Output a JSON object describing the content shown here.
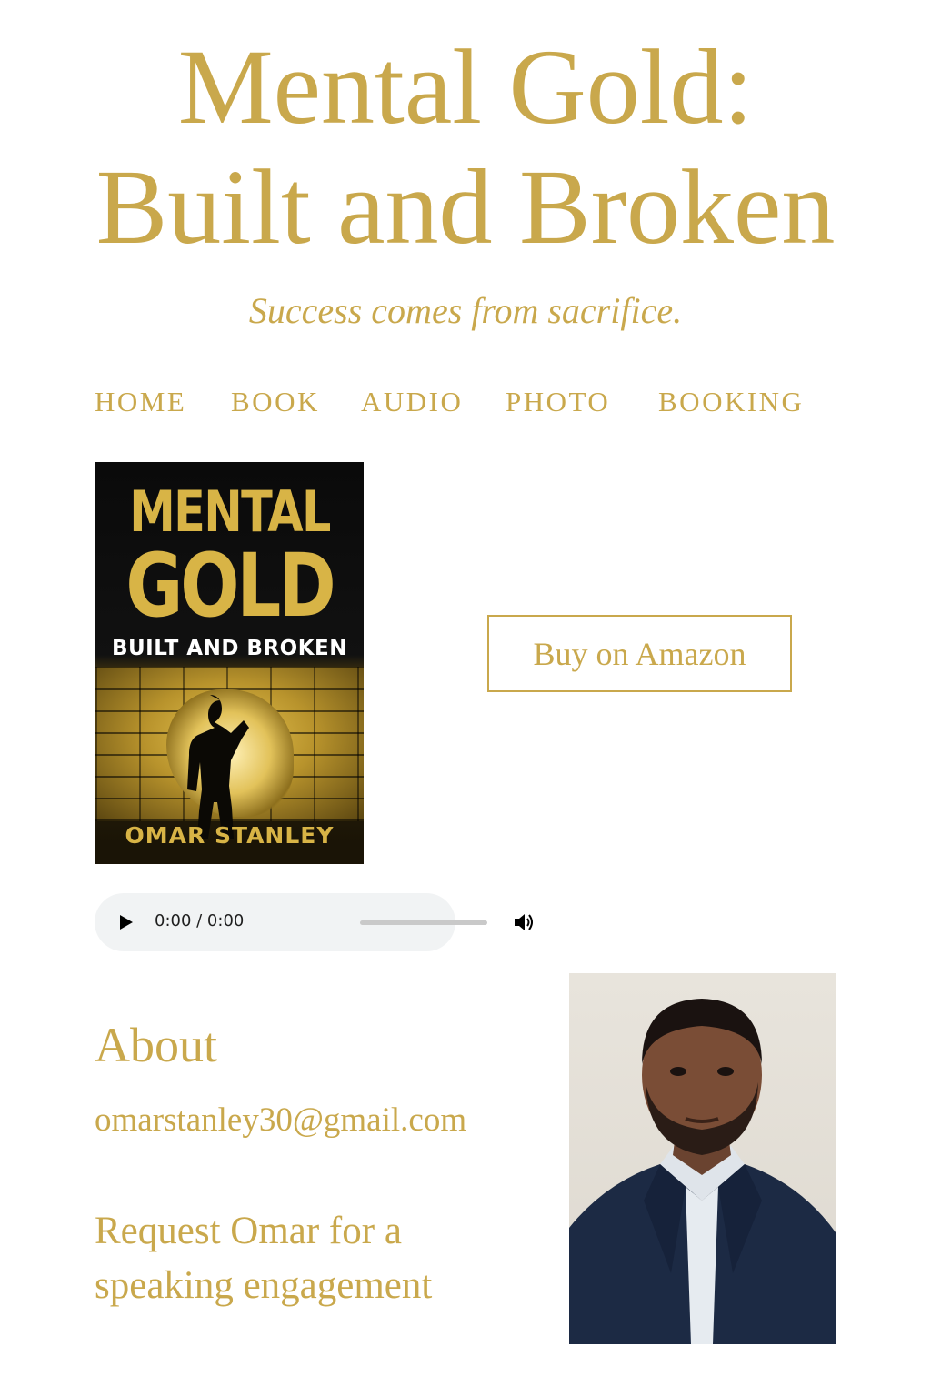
{
  "header": {
    "title_line1": "Mental Gold:",
    "title_line2": "Built and Broken",
    "tagline": "Success comes from sacrifice."
  },
  "nav": {
    "items": [
      {
        "label": "HOME"
      },
      {
        "label": "BOOK"
      },
      {
        "label": "AUDIO"
      },
      {
        "label": "PHOTO"
      },
      {
        "label": "BOOKING"
      }
    ]
  },
  "book_cover": {
    "line1": "MENTAL",
    "line2": "GOLD",
    "line3": "BUILT AND BROKEN",
    "author": "OMAR STANLEY"
  },
  "buy_button": {
    "label": "Buy on Amazon"
  },
  "audio_player": {
    "time": "0:00 / 0:00",
    "progress": 0,
    "play_icon": "play-icon",
    "volume_icon": "volume-icon"
  },
  "about": {
    "heading": "About",
    "email": "omarstanley30@gmail.com",
    "request_link": "Request Omar for a speaking engagement"
  },
  "colors": {
    "gold": "#c9a84c",
    "background": "#ffffff",
    "player_bg": "#f1f3f4"
  }
}
